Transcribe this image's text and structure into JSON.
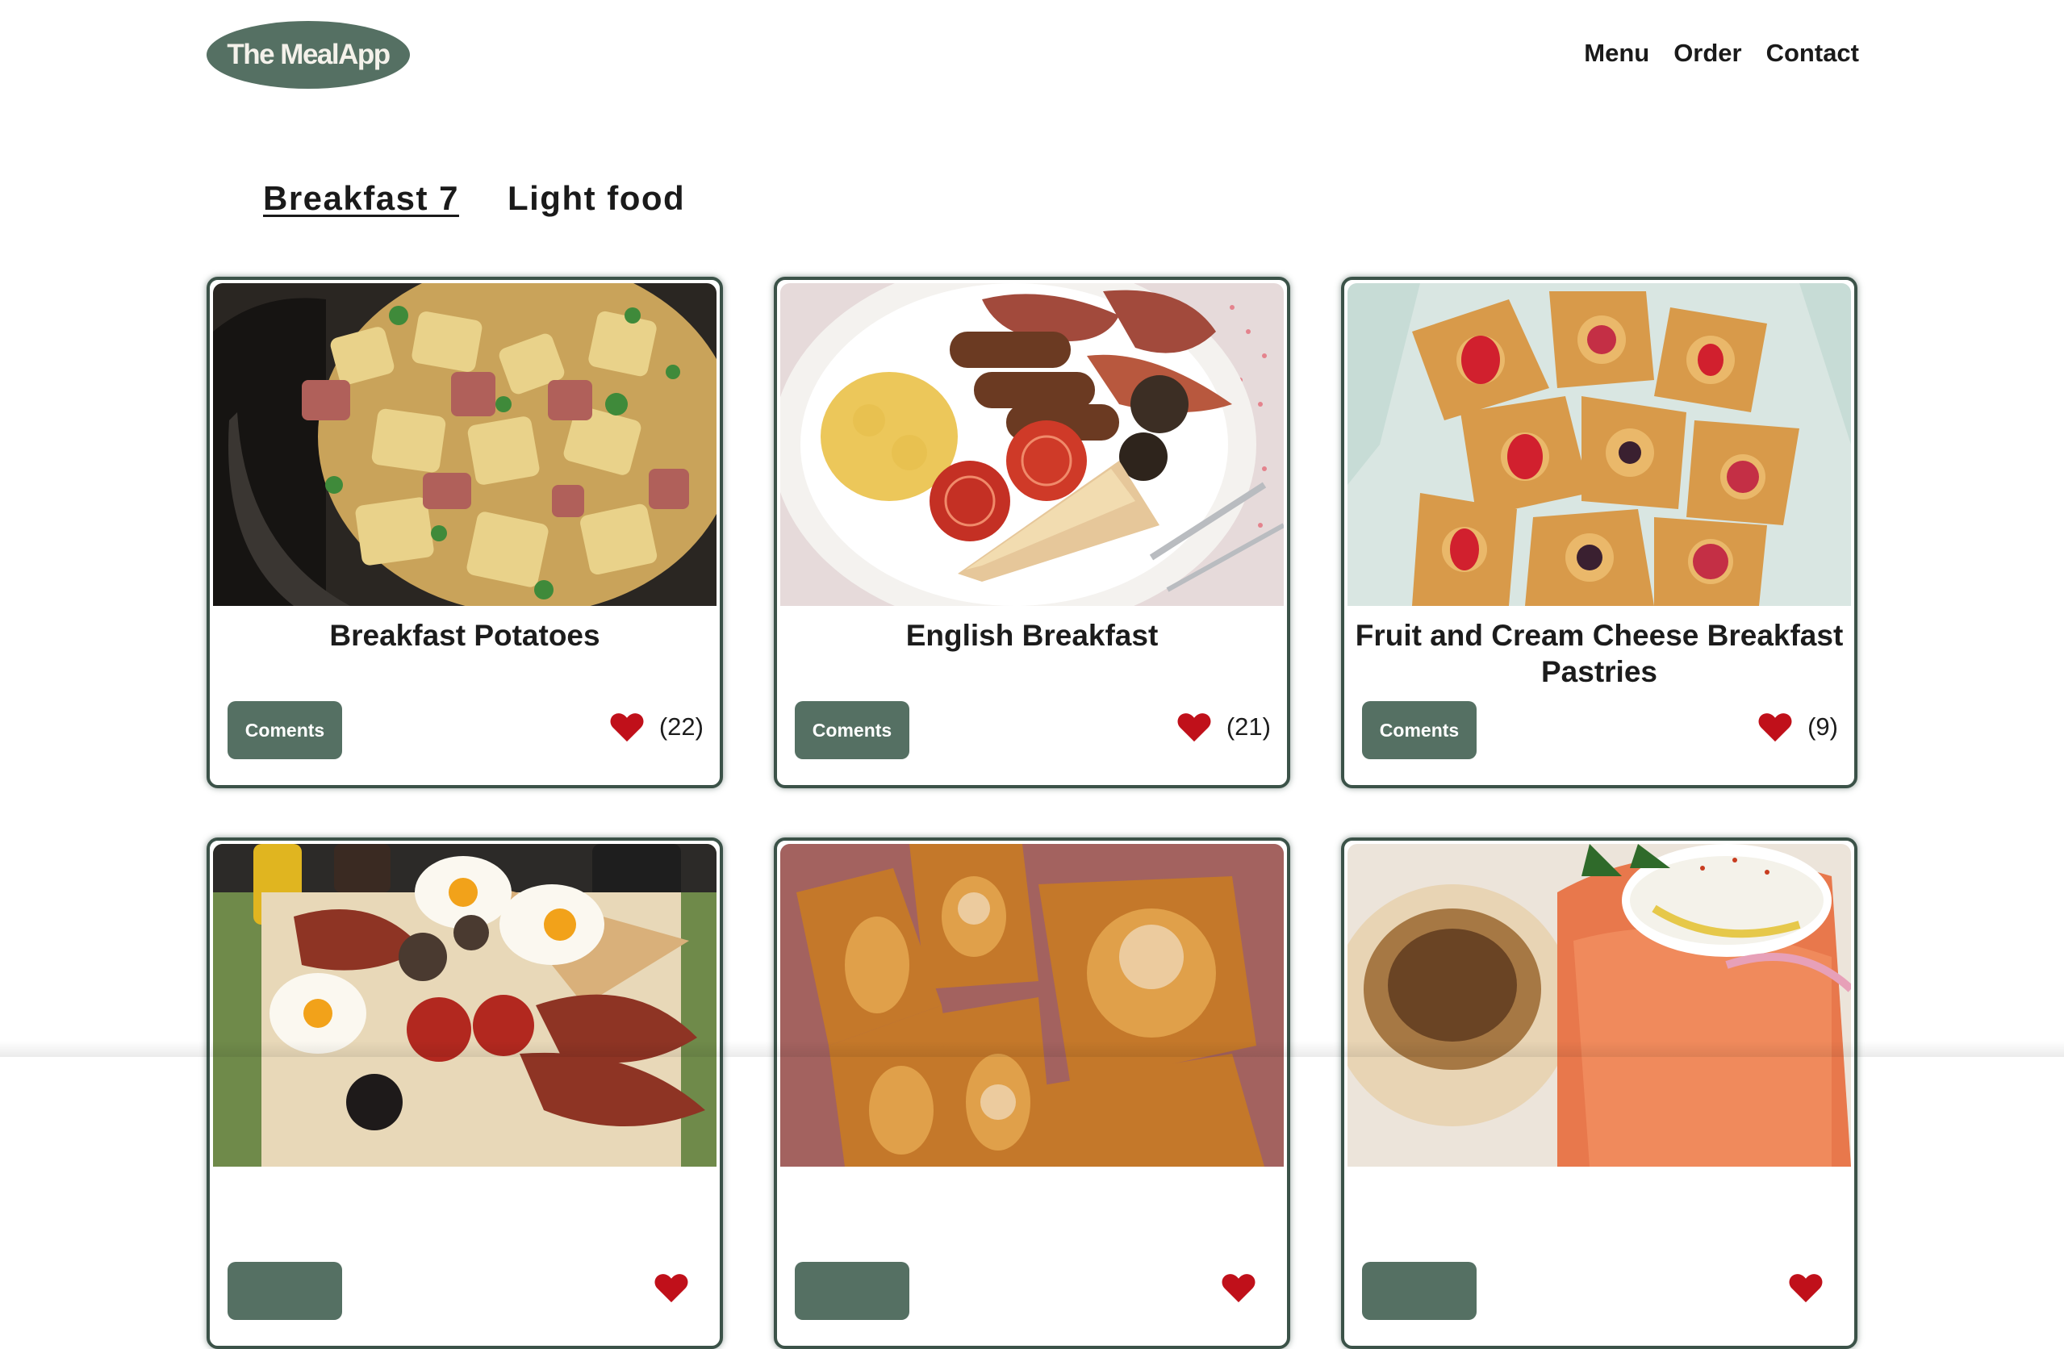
{
  "header": {
    "logo_text": "The MealApp",
    "nav": [
      "Menu",
      "Order",
      "Contact"
    ]
  },
  "tabs": [
    {
      "label": "Breakfast 7",
      "active": true
    },
    {
      "label": "Light food",
      "active": false
    }
  ],
  "meals": [
    {
      "title": "Breakfast Potatoes",
      "button": "Coments",
      "likes": "(22)"
    },
    {
      "title": "English Breakfast",
      "button": "Coments",
      "likes": "(21)"
    },
    {
      "title": "Fruit and Cream Cheese Breakfast Pastries",
      "button": "Coments",
      "likes": "(9)"
    },
    {
      "title": "",
      "button": "",
      "likes": ""
    },
    {
      "title": "",
      "button": "",
      "likes": ""
    },
    {
      "title": "",
      "button": "",
      "likes": ""
    }
  ],
  "colors": {
    "accent": "#557063",
    "card_border": "#3b5248",
    "heart": "#c0101a"
  },
  "icons": {
    "like": "heart-icon"
  }
}
